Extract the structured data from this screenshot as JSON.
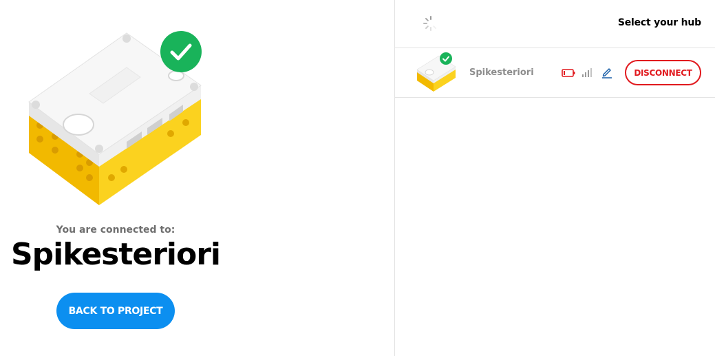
{
  "connection": {
    "label": "You are connected to:",
    "hub_name": "Spikesteriori",
    "back_button_label": "BACK TO PROJECT"
  },
  "hub_selector": {
    "heading": "Select your hub",
    "hubs": [
      {
        "name": "Spikesteriori",
        "status": "connected",
        "battery_icon": "battery-low-icon",
        "signal_icon": "signal-strength-icon",
        "edit_icon": "pencil-icon",
        "action_label": "DISCONNECT"
      }
    ]
  },
  "colors": {
    "primary_blue": "#0c8ff0",
    "connected_green": "#19b35a",
    "danger_red": "#e1191e",
    "hub_yellow": "#f9c81a",
    "muted_text": "#8d8d8d"
  }
}
